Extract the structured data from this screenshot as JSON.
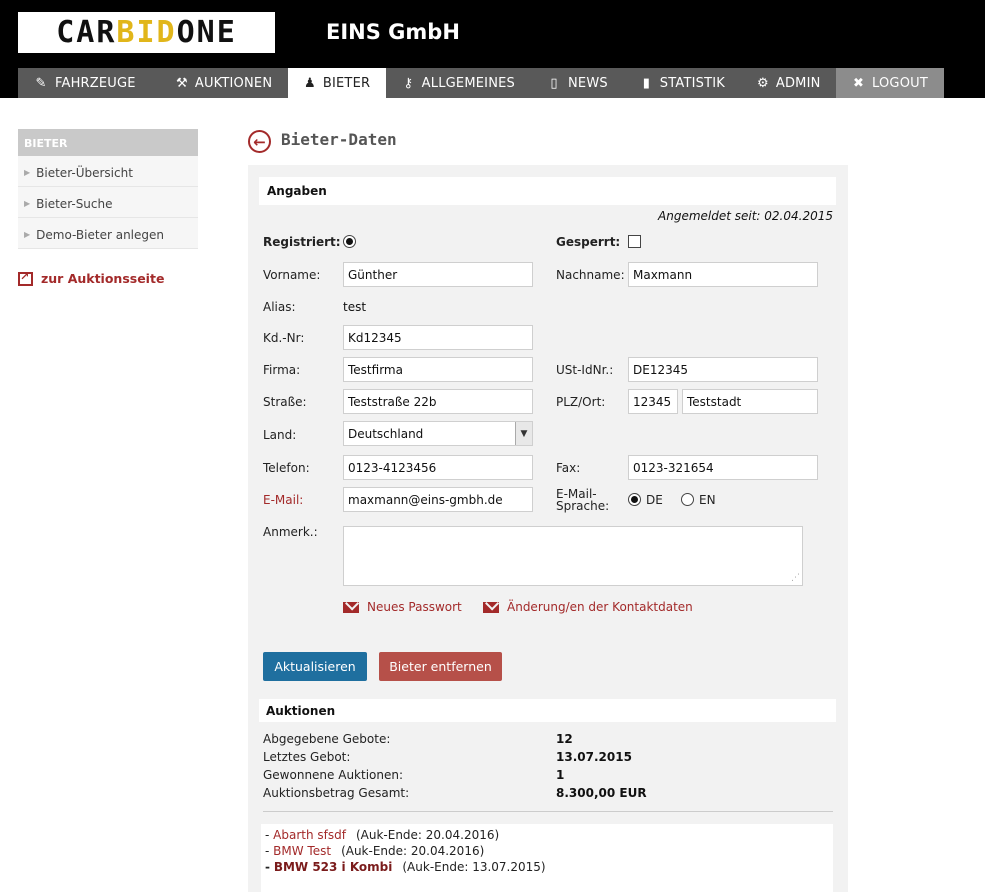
{
  "header": {
    "logo": {
      "part1": "CAR",
      "part2": "BID",
      "part3": "ONE"
    },
    "company": "EINS GmbH"
  },
  "nav": [
    {
      "label": "FAHRZEUGE",
      "icon": "edit-icon"
    },
    {
      "label": "AUKTIONEN",
      "icon": "gavel-icon"
    },
    {
      "label": "BIETER",
      "icon": "user-icon",
      "active": true
    },
    {
      "label": "ALLGEMEINES",
      "icon": "key-icon"
    },
    {
      "label": "NEWS",
      "icon": "document-icon"
    },
    {
      "label": "STATISTIK",
      "icon": "bar-chart-icon"
    },
    {
      "label": "ADMIN",
      "icon": "gear-icon"
    },
    {
      "label": "LOGOUT",
      "icon": "close-icon"
    }
  ],
  "sidebar": {
    "heading": "BIETER",
    "items": [
      {
        "label": "Bieter-Übersicht"
      },
      {
        "label": "Bieter-Suche"
      },
      {
        "label": "Demo-Bieter anlegen"
      }
    ],
    "auction_link": "zur Auktionsseite"
  },
  "page": {
    "title": "Bieter-Daten"
  },
  "form": {
    "section_title": "Angaben",
    "registered_since": "Angemeldet seit: 02.04.2015",
    "registered_label": "Registriert:",
    "blocked_label": "Gesperrt:",
    "firstname_label": "Vorname:",
    "firstname": "Günther",
    "lastname_label": "Nachname:",
    "lastname": "Maxmann",
    "alias_label": "Alias:",
    "alias": "test",
    "customer_no_label": "Kd.-Nr:",
    "customer_no": "Kd12345",
    "company_label": "Firma:",
    "company": "Testfirma",
    "vat_label": "USt-IdNr.:",
    "vat": "DE12345",
    "street_label": "Straße:",
    "street": "Teststraße 22b",
    "zipcity_label": "PLZ/Ort:",
    "zip": "12345",
    "city": "Teststadt",
    "country_label": "Land:",
    "country": "Deutschland",
    "phone_label": "Telefon:",
    "phone": "0123-4123456",
    "fax_label": "Fax:",
    "fax": "0123-321654",
    "email_label": "E-Mail:",
    "email": "maxmann@eins-gmbh.de",
    "email_lang_label_1": "E-Mail-",
    "email_lang_label_2": "Sprache:",
    "lang_de": "DE",
    "lang_en": "EN",
    "notes_label": "Anmerk.:",
    "notes": "",
    "new_password_link": "Neues Passwort",
    "contact_change_link": "Änderung/en der Kontaktdaten",
    "update_button": "Aktualisieren",
    "remove_button": "Bieter entfernen"
  },
  "auctions": {
    "section_title": "Auktionen",
    "stats": [
      {
        "label": "Abgegebene Gebote:",
        "value": "12"
      },
      {
        "label": "Letztes Gebot:",
        "value": "13.07.2015"
      },
      {
        "label": "Gewonnene Auktionen:",
        "value": "1"
      },
      {
        "label": "Auktionsbetrag Gesamt:",
        "value": "8.300,00 EUR"
      }
    ],
    "list": [
      {
        "name": "Abarth sfsdf",
        "end": "(Auk-Ende: 20.04.2016)"
      },
      {
        "name": "BMW Test",
        "end": "(Auk-Ende: 20.04.2016)"
      },
      {
        "name": "BMW 523 i Kombi",
        "end": "(Auk-Ende: 13.07.2015)"
      }
    ]
  },
  "colors": {
    "accent_red": "#a32a2a",
    "primary_blue": "#1f6f9f",
    "danger": "#b65049",
    "logo_yellow": "#e1b61a"
  }
}
